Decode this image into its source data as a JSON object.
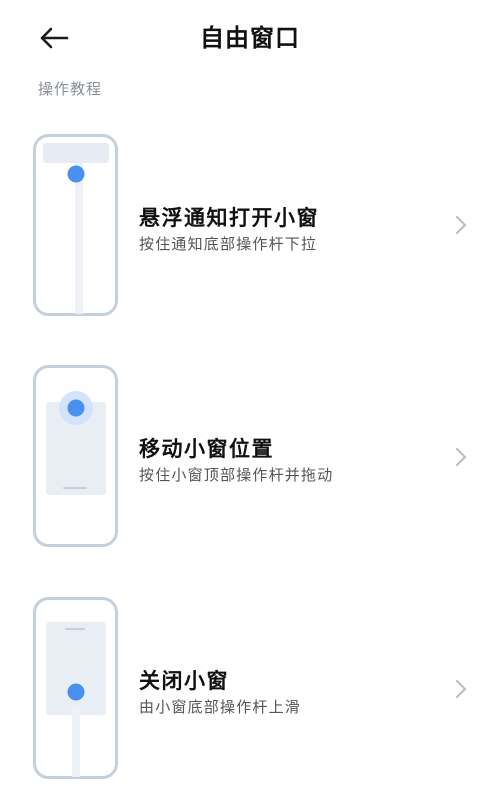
{
  "header": {
    "title": "自由窗口",
    "back_icon": "arrow-left-icon"
  },
  "section": {
    "label": "操作教程"
  },
  "items": [
    {
      "title": "悬浮通知打开小窗",
      "subtitle": "按住通知底部操作杆下拉",
      "illustration": "phone-notification-drag-down-illustration",
      "chevron_icon": "chevron-right-icon"
    },
    {
      "title": "移动小窗位置",
      "subtitle": "按住小窗顶部操作杆并拖动",
      "illustration": "phone-window-move-illustration",
      "chevron_icon": "chevron-right-icon"
    },
    {
      "title": "关闭小窗",
      "subtitle": "由小窗底部操作杆上滑",
      "illustration": "phone-window-close-illustration",
      "chevron_icon": "chevron-right-icon"
    }
  ],
  "colors": {
    "accent_blue": "#4a90f0",
    "phone_outline": "#c5d0de",
    "card_fill": "#e9edf4",
    "chevron": "#b8bcc4"
  }
}
